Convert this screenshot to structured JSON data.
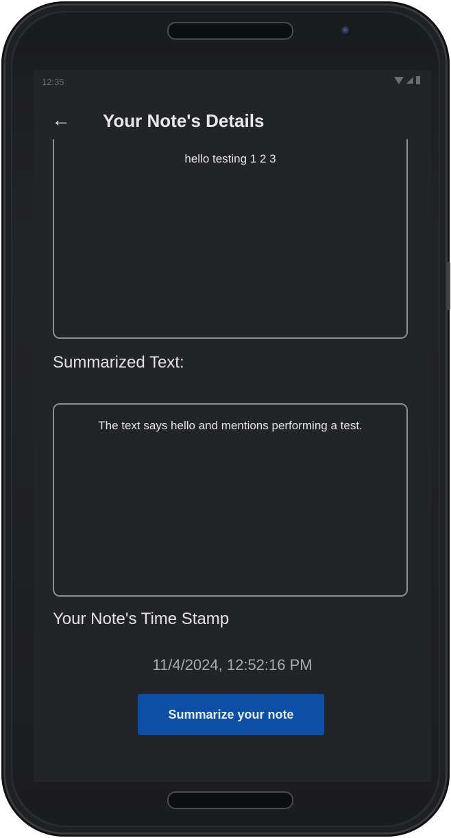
{
  "status_bar": {
    "time": "12:35"
  },
  "app_bar": {
    "title": "Your Note's Details",
    "back_icon": "arrow-left-icon"
  },
  "note": {
    "text": "hello testing 1 2 3"
  },
  "summary": {
    "label": "Summarized Text:",
    "text": "The text says hello and mentions performing a test."
  },
  "timestamp": {
    "label": "Your Note's Time Stamp",
    "value": "11/4/2024, 12:52:16 PM"
  },
  "actions": {
    "summarize_label": "Summarize your note"
  },
  "colors": {
    "screen_bg": "#232427",
    "button_bg": "#0b4fa6",
    "border": "#8d8e92"
  }
}
